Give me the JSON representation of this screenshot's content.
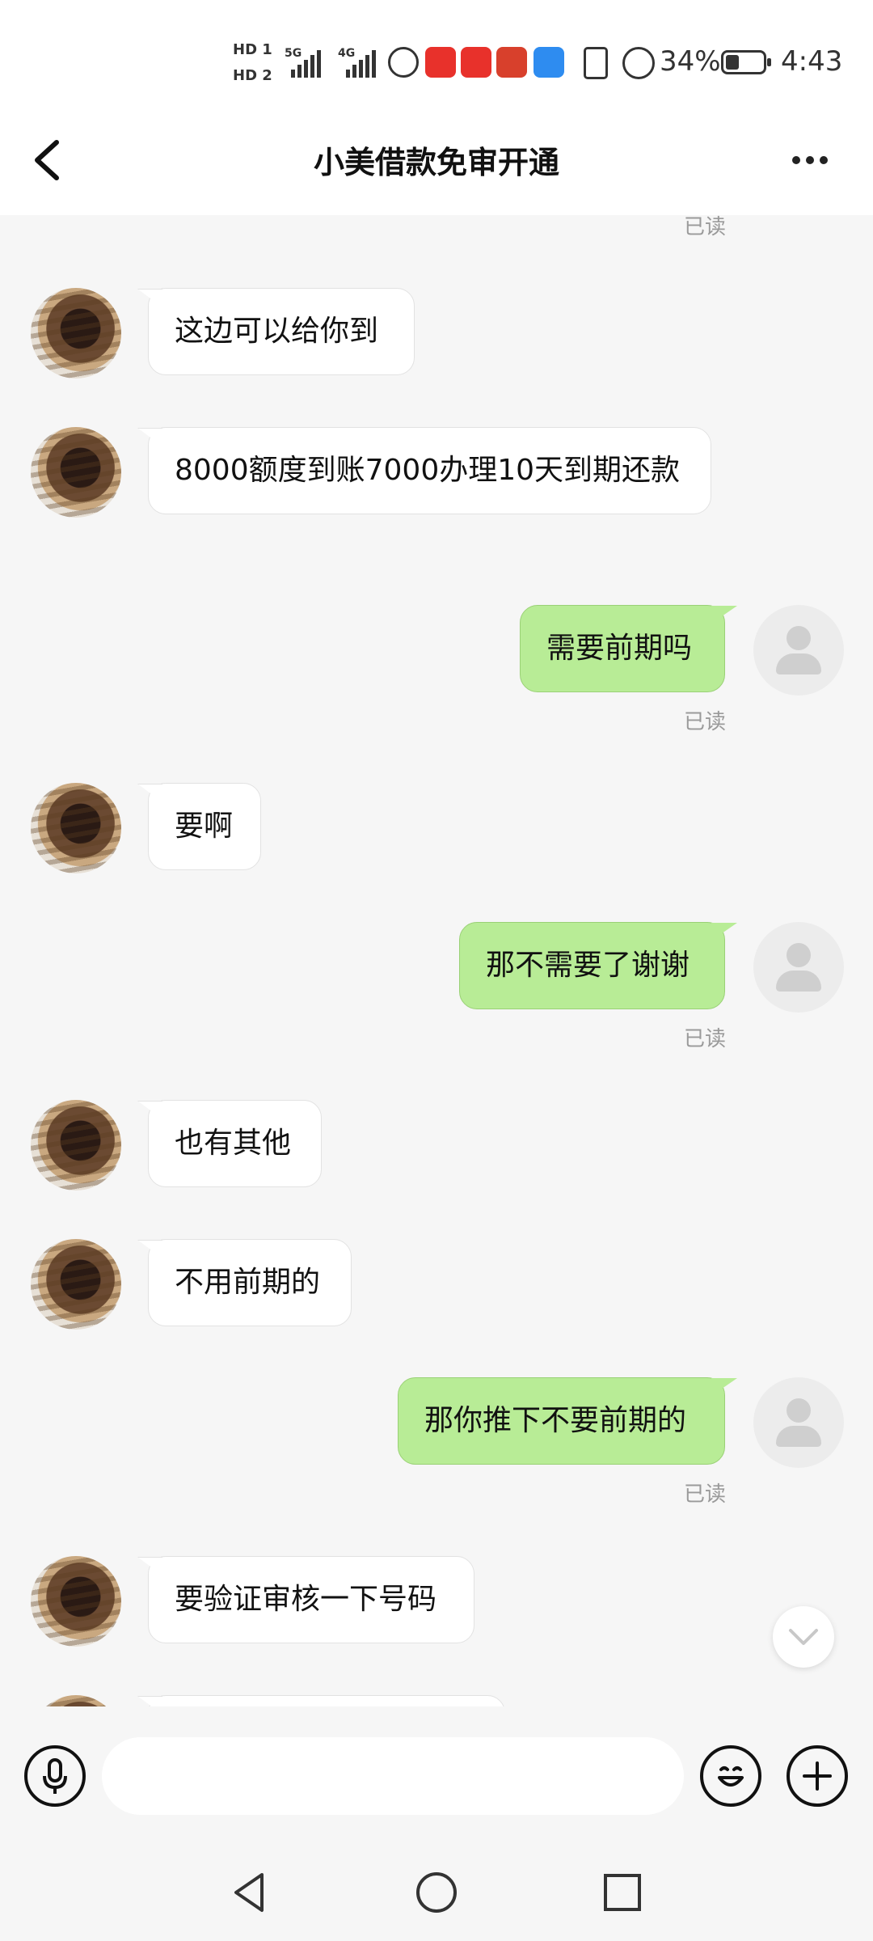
{
  "status_bar": {
    "hd1": "HD 1",
    "hd2": "HD 2",
    "sim1_label": "5G",
    "sim2_label": "4G",
    "battery_percent": "34%",
    "time": "4:43"
  },
  "header": {
    "title": "小美借款免审开通",
    "back_icon": "chevron-left-icon",
    "more_icon": "more-horizontal-icon"
  },
  "read_label": "已读",
  "messages": [
    {
      "side": "left",
      "text": "这边可以给你到"
    },
    {
      "side": "left",
      "text": "8000额度到账7000办理10天到期还款"
    },
    {
      "side": "right",
      "text": "需要前期吗",
      "status": "已读"
    },
    {
      "side": "left",
      "text": "要啊"
    },
    {
      "side": "right",
      "text": "那不需要了谢谢",
      "status": "已读"
    },
    {
      "side": "left",
      "text": "也有其他"
    },
    {
      "side": "left",
      "text": "不用前期的"
    },
    {
      "side": "right",
      "text": "那你推下不要前期的",
      "status": "已读"
    },
    {
      "side": "left",
      "text": "要验证审核一下号码"
    }
  ],
  "input": {
    "voice_icon": "microphone-icon",
    "placeholder": "",
    "emoji_icon": "emoji-icon",
    "plus_icon": "plus-icon"
  },
  "colors": {
    "sent_bubble": "#b8ec96",
    "received_bubble": "#ffffff",
    "background": "#f6f6f6"
  }
}
